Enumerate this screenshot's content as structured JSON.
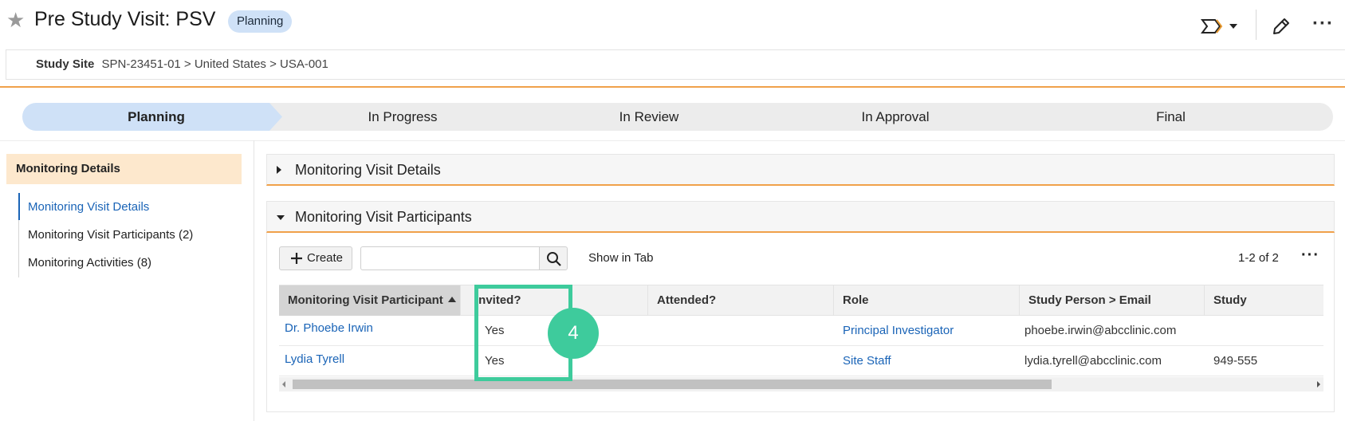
{
  "header": {
    "title": "Pre Study Visit: PSV",
    "state_badge": "Planning"
  },
  "breadcrumb": {
    "label": "Study Site",
    "path": "SPN-23451-01 > United States > USA-001"
  },
  "stages": [
    "Planning",
    "In Progress",
    "In Review",
    "In Approval",
    "Final"
  ],
  "active_stage": "Planning",
  "left_nav": {
    "header": "Monitoring Details",
    "items": [
      {
        "label": "Monitoring Visit Details",
        "active": true
      },
      {
        "label": "Monitoring Visit Participants (2)",
        "active": false
      },
      {
        "label": "Monitoring Activities (8)",
        "active": false
      }
    ]
  },
  "sections": {
    "details_title": "Monitoring Visit Details",
    "participants_title": "Monitoring Visit Participants"
  },
  "toolbar": {
    "create_label": "Create",
    "search_value": "",
    "show_in_tab": "Show in Tab",
    "pager": "1-2 of 2"
  },
  "table": {
    "columns": [
      "Monitoring Visit Participant",
      "Invited?",
      "Attended?",
      "Role",
      "Study Person > Email",
      "Study"
    ],
    "rows": [
      {
        "participant": "Dr. Phoebe Irwin",
        "invited": "Yes",
        "attended": "",
        "role": "Principal Investigator",
        "email": "phoebe.irwin@abcclinic.com",
        "study": ""
      },
      {
        "participant": "Lydia Tyrell",
        "invited": "Yes",
        "attended": "",
        "role": "Site Staff",
        "email": "lydia.tyrell@abcclinic.com",
        "study": "949-555"
      }
    ]
  },
  "callout": {
    "step_number": "4",
    "color": "#3ecb9c"
  },
  "colors": {
    "accent_orange": "#f0a14a",
    "link_blue": "#1a64b7",
    "active_stage": "#cfe1f7",
    "nav_header_bg": "#fde8cd"
  },
  "icons": {
    "favorite": "star-icon",
    "workflow": "workflow-icon",
    "edit": "pencil-icon",
    "more": "more-icon",
    "create": "plus-icon",
    "search": "search-icon"
  }
}
